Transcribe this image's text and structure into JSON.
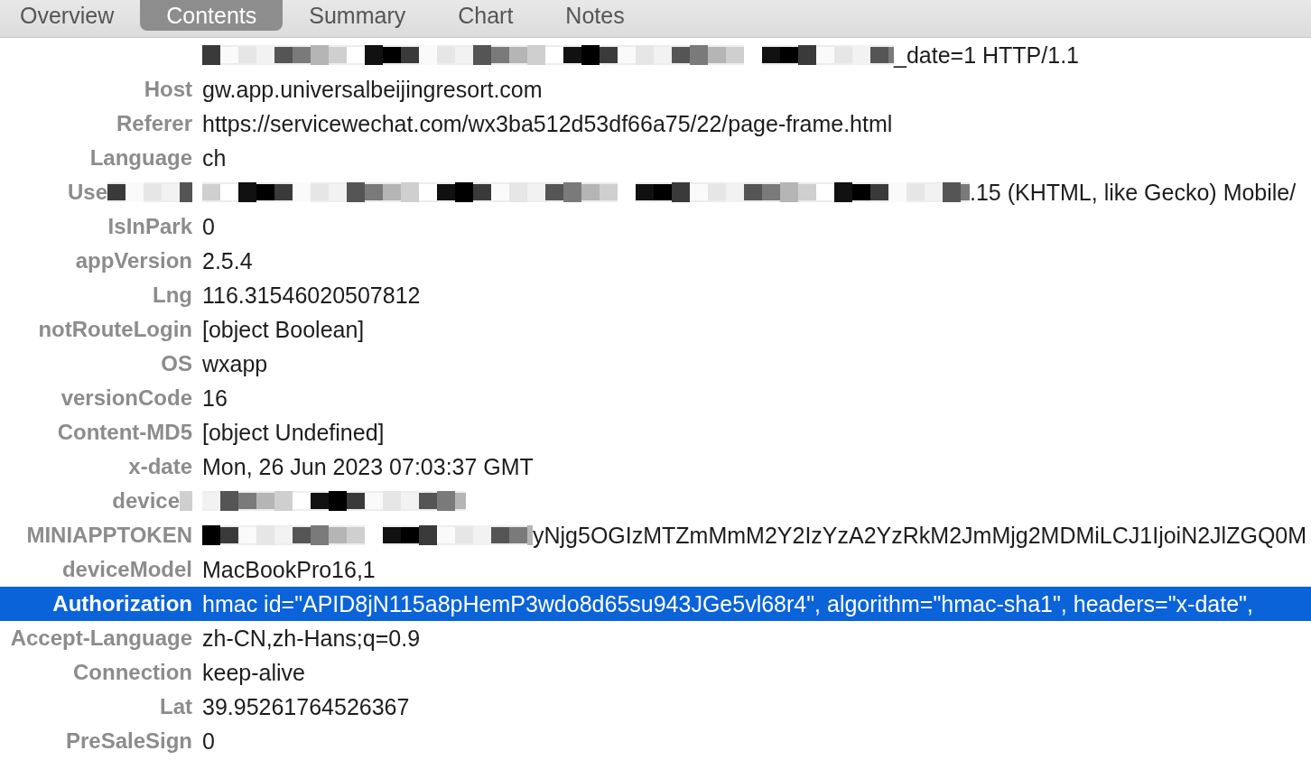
{
  "tabs": [
    {
      "label": "Overview",
      "selected": false
    },
    {
      "label": "Contents",
      "selected": true
    },
    {
      "label": "Summary",
      "selected": false
    },
    {
      "label": "Chart",
      "selected": false
    },
    {
      "label": "Notes",
      "selected": false
    }
  ],
  "headers": [
    {
      "value": "_date=1 HTTP/1.1",
      "redacted": true,
      "key_covered": false,
      "selected": false
    },
    {
      "key": "Host",
      "value": "gw.app.universalbeijingresort.com",
      "redacted": false,
      "key_covered": false,
      "selected": false
    },
    {
      "key": "Referer",
      "value": "https://servicewechat.com/wx3ba512d53df66a75/22/page-frame.html",
      "redacted": false,
      "key_covered": false,
      "selected": false
    },
    {
      "key": "Language",
      "value": "ch",
      "redacted": false,
      "key_covered": false,
      "selected": false
    },
    {
      "key": "Use",
      "value": ".15 (KHTML, like Gecko) Mobile/",
      "redacted": true,
      "key_covered": true,
      "selected": false
    },
    {
      "key": "IsInPark",
      "value": "0",
      "redacted": false,
      "key_covered": false,
      "selected": false
    },
    {
      "key": "appVersion",
      "value": "2.5.4",
      "redacted": false,
      "key_covered": false,
      "selected": false
    },
    {
      "key": "Lng",
      "value": "116.31546020507812",
      "redacted": false,
      "key_covered": false,
      "selected": false
    },
    {
      "key": "notRouteLogin",
      "value": "[object Boolean]",
      "redacted": false,
      "key_covered": false,
      "selected": false
    },
    {
      "key": "OS",
      "value": "wxapp",
      "redacted": false,
      "key_covered": false,
      "selected": false
    },
    {
      "key": "versionCode",
      "value": "16",
      "redacted": false,
      "key_covered": false,
      "selected": false
    },
    {
      "key": "Content-MD5",
      "value": "[object Undefined]",
      "redacted": false,
      "key_covered": false,
      "selected": false
    },
    {
      "key": "x-date",
      "value": "Mon, 26 Jun 2023 07:03:37 GMT",
      "redacted": false,
      "key_covered": false,
      "selected": false
    },
    {
      "key": "device",
      "redacted": true,
      "key_covered": true,
      "selected": false
    },
    {
      "key": "MINIAPPTOKEN",
      "value": "yNjg5OGIzMTZmMmM2Y2IzYzA2YzRkM2JmMjg2MDMiLCJ1IjoiN2JlZGQ0M",
      "redacted": true,
      "key_covered": false,
      "selected": false
    },
    {
      "key": "deviceModel",
      "value": "MacBookPro16,1",
      "redacted": false,
      "key_covered": false,
      "selected": false
    },
    {
      "key": "Authorization",
      "value": "hmac id=\"APID8jN115a8pHemP3wdo8d65su943JGe5vl68r4\", algorithm=\"hmac-sha1\", headers=\"x-date\",",
      "redacted": false,
      "key_covered": false,
      "selected": true
    },
    {
      "key": "Accept-Language",
      "value": "zh-CN,zh-Hans;q=0.9",
      "redacted": false,
      "key_covered": false,
      "selected": false
    },
    {
      "key": "Connection",
      "value": "keep-alive",
      "redacted": false,
      "key_covered": false,
      "selected": false
    },
    {
      "key": "Lat",
      "value": "39.95261764526367",
      "redacted": false,
      "key_covered": false,
      "selected": false
    },
    {
      "key": "PreSaleSign",
      "value": "0",
      "redacted": false,
      "key_covered": false,
      "selected": false
    }
  ]
}
